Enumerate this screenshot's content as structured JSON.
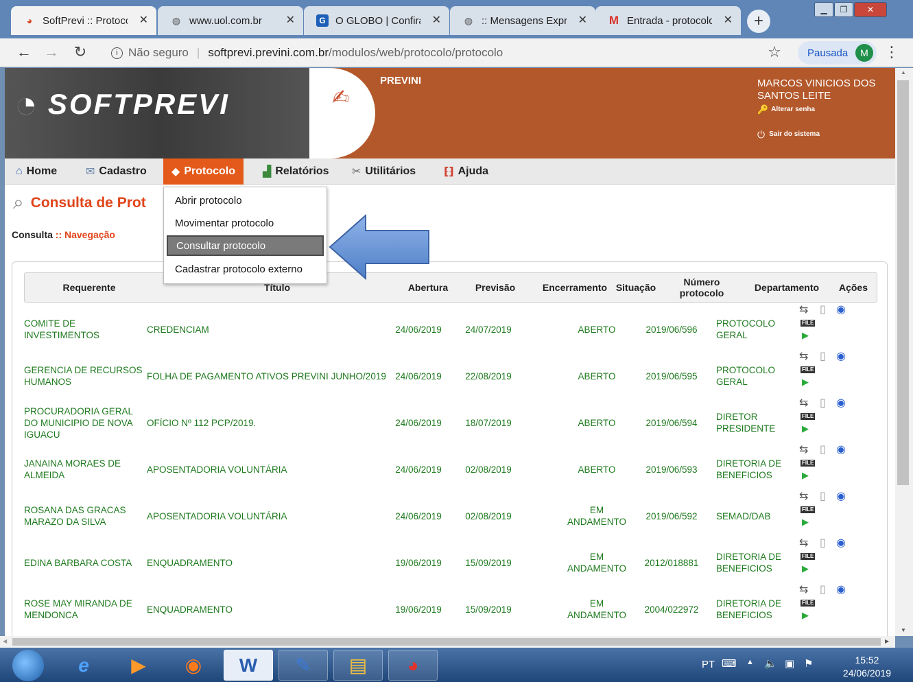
{
  "browser": {
    "tabs": [
      {
        "title": "SoftPrevi :: Protoco",
        "icon": "softprevi-icon",
        "active": true
      },
      {
        "title": "www.uol.com.br",
        "icon": "globe-icon",
        "active": false
      },
      {
        "title": "O GLOBO | Confira",
        "icon": "g-icon",
        "active": false
      },
      {
        "title": ":: Mensagens Expre",
        "icon": "globe-icon",
        "active": false
      },
      {
        "title": "Entrada - protocolo",
        "icon": "gmail-icon",
        "active": false
      }
    ],
    "not_secure_label": "Não seguro",
    "url_host": "softprevi.previni.com.br",
    "url_path": "/modulos/web/protocolo/protocolo",
    "profile_label": "Pausada",
    "profile_initial": "M"
  },
  "header": {
    "logo_text": "SOFTPREVI",
    "org_label": "PREVINI",
    "user_name": "MARCOS VINICIOS DOS SANTOS LEITE",
    "change_password": "Alterar senha",
    "logout": "Sair do sistema"
  },
  "menu": {
    "items": [
      {
        "label": "Home",
        "icon": "home-icon"
      },
      {
        "label": "Cadastro",
        "icon": "cadastro-icon"
      },
      {
        "label": "Protocolo",
        "icon": "protocolo-icon"
      },
      {
        "label": "Relatórios",
        "icon": "chart-icon"
      },
      {
        "label": "Utilitários",
        "icon": "tools-icon"
      },
      {
        "label": "Ajuda",
        "icon": "help-icon"
      }
    ],
    "active_index": 2,
    "dropdown": [
      {
        "label": "Abrir protocolo"
      },
      {
        "label": "Movimentar protocolo"
      },
      {
        "label": "Consultar protocolo",
        "selected": true
      },
      {
        "label": "Cadastrar protocolo externo"
      }
    ]
  },
  "page": {
    "title": "Consulta de Prot",
    "breadcrumb_root": "Consulta",
    "breadcrumb_sep": "::",
    "breadcrumb_active": "Navegação"
  },
  "table": {
    "columns": [
      "Requerente",
      "Título",
      "Abertura",
      "Previsão",
      "Encerramento",
      "Situação",
      "Número protocolo",
      "Departamento",
      "Ações"
    ],
    "rows": [
      {
        "requerente": "COMITE DE INVESTIMENTOS",
        "titulo": "CREDENCIAM",
        "abertura": "24/06/2019",
        "previsao": "24/07/2019",
        "encerramento": "",
        "situacao": "ABERTO",
        "numero": "2019/06/596",
        "departamento": "PROTOCOLO GERAL"
      },
      {
        "requerente": "GERENCIA DE RECURSOS HUMANOS",
        "titulo": "FOLHA DE PAGAMENTO ATIVOS PREVINI JUNHO/2019",
        "abertura": "24/06/2019",
        "previsao": "22/08/2019",
        "encerramento": "",
        "situacao": "ABERTO",
        "numero": "2019/06/595",
        "departamento": "PROTOCOLO GERAL"
      },
      {
        "requerente": "PROCURADORIA GERAL DO MUNICIPIO DE NOVA IGUACU",
        "titulo": "OFÍCIO Nº 112 PCP/2019.",
        "abertura": "24/06/2019",
        "previsao": "18/07/2019",
        "encerramento": "",
        "situacao": "ABERTO",
        "numero": "2019/06/594",
        "departamento": "DIRETOR PRESIDENTE"
      },
      {
        "requerente": "JANAINA MORAES DE ALMEIDA",
        "titulo": "APOSENTADORIA VOLUNTÁRIA",
        "abertura": "24/06/2019",
        "previsao": "02/08/2019",
        "encerramento": "",
        "situacao": "ABERTO",
        "numero": "2019/06/593",
        "departamento": "DIRETORIA DE BENEFICIOS"
      },
      {
        "requerente": "ROSANA DAS GRACAS MARAZO DA SILVA",
        "titulo": "APOSENTADORIA VOLUNTÁRIA",
        "abertura": "24/06/2019",
        "previsao": "02/08/2019",
        "encerramento": "",
        "situacao": "EM ANDAMENTO",
        "numero": "2019/06/592",
        "departamento": "SEMAD/DAB"
      },
      {
        "requerente": "EDINA BARBARA COSTA",
        "titulo": "ENQUADRAMENTO",
        "abertura": "19/06/2019",
        "previsao": "15/09/2019",
        "encerramento": "",
        "situacao": "EM ANDAMENTO",
        "numero": "2012/018881",
        "departamento": "DIRETORIA DE BENEFICIOS"
      },
      {
        "requerente": "ROSE MAY MIRANDA DE MENDONCA",
        "titulo": "ENQUADRAMENTO",
        "abertura": "19/06/2019",
        "previsao": "15/09/2019",
        "encerramento": "",
        "situacao": "EM ANDAMENTO",
        "numero": "2004/022972",
        "departamento": "DIRETORIA DE BENEFICIOS"
      }
    ],
    "action_icons": [
      "transfer-icon",
      "document-icon",
      "view-icon",
      "file-icon",
      "play-icon"
    ],
    "file_label": "FILE"
  },
  "taskbar": {
    "apps": [
      "windows-start-icon",
      "internet-explorer-icon",
      "media-player-icon",
      "firefox-icon",
      "word-icon",
      "paint-icon",
      "file-explorer-icon",
      "chrome-icon"
    ],
    "language": "PT",
    "time": "15:52",
    "date": "24/06/2019"
  },
  "colors": {
    "accent": "#e45a1a",
    "link_green": "#1e7a1e",
    "banner_orange": "#b3582b"
  }
}
